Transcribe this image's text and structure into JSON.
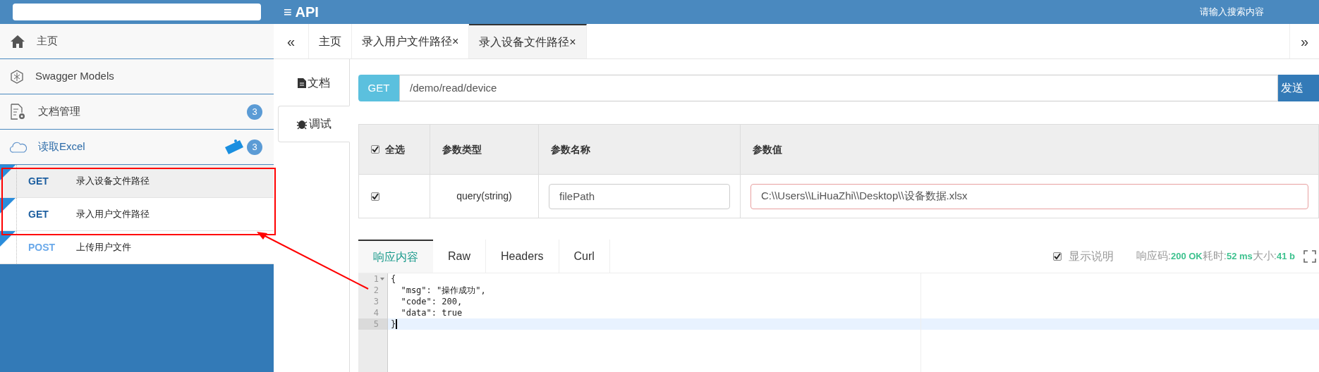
{
  "header": {
    "title": "≡ API",
    "search_placeholder": "请输入搜索内容"
  },
  "sidebar": {
    "items": [
      {
        "kind": "home",
        "label": "主页"
      },
      {
        "kind": "models",
        "label": "Swagger Models"
      },
      {
        "kind": "docs",
        "label": "文档管理",
        "count": "3"
      },
      {
        "kind": "group",
        "label": "读取Excel",
        "count": "3",
        "new": true,
        "children": [
          {
            "method": "GET",
            "label": "录入设备文件路径",
            "selected": true,
            "new": true
          },
          {
            "method": "GET",
            "label": "录入用户文件路径",
            "selected": false,
            "new": true
          },
          {
            "method": "POST",
            "label": "上传用户文件",
            "selected": false,
            "new": true
          }
        ]
      }
    ]
  },
  "tabs": {
    "prev": "«",
    "next": "»",
    "items": [
      {
        "label": "主页",
        "closable": false,
        "selected": false
      },
      {
        "label": "录入用户文件路径",
        "closable": true,
        "selected": false
      },
      {
        "label": "录入设备文件路径",
        "closable": true,
        "selected": true
      }
    ],
    "close": "×"
  },
  "side_tabs": [
    {
      "kind": "doc",
      "label": "文档",
      "selected": false
    },
    {
      "kind": "debug",
      "label": "调试",
      "selected": true
    }
  ],
  "request": {
    "method": "GET",
    "url": "/demo/read/device",
    "send": "发送"
  },
  "params": {
    "columns": [
      {
        "label": "全选",
        "checked": true
      },
      {
        "label": "参数类型"
      },
      {
        "label": "参数名称"
      },
      {
        "label": "参数值"
      }
    ],
    "rows": [
      {
        "checked": true,
        "type": "query(string)",
        "name": "filePath",
        "value": "C:\\\\Users\\\\LiHuaZhi\\\\Desktop\\\\设备数据.xlsx"
      }
    ]
  },
  "response": {
    "tabs": [
      {
        "label": "响应内容",
        "selected": true
      },
      {
        "label": "Raw",
        "selected": false
      },
      {
        "label": "Headers",
        "selected": false
      },
      {
        "label": "Curl",
        "selected": false
      }
    ],
    "show_desc": {
      "label": "显示说明",
      "checked": true
    },
    "status": [
      {
        "label": "响应码:",
        "value": "200 OK"
      },
      {
        "label": "耗时:",
        "value": "52 ms"
      },
      {
        "label": "大小:",
        "value": "41 b"
      }
    ],
    "lines": [
      {
        "number": "1",
        "text": "{",
        "fold": true,
        "active": false
      },
      {
        "number": "2",
        "text": "  \"msg\": \"操作成功\",",
        "fold": false,
        "active": false
      },
      {
        "number": "3",
        "text": "  \"code\": 200,",
        "fold": false,
        "active": false
      },
      {
        "number": "4",
        "text": "  \"data\": true",
        "fold": false,
        "active": false
      },
      {
        "number": "5",
        "text": "}",
        "fold": false,
        "active": true
      }
    ]
  }
}
